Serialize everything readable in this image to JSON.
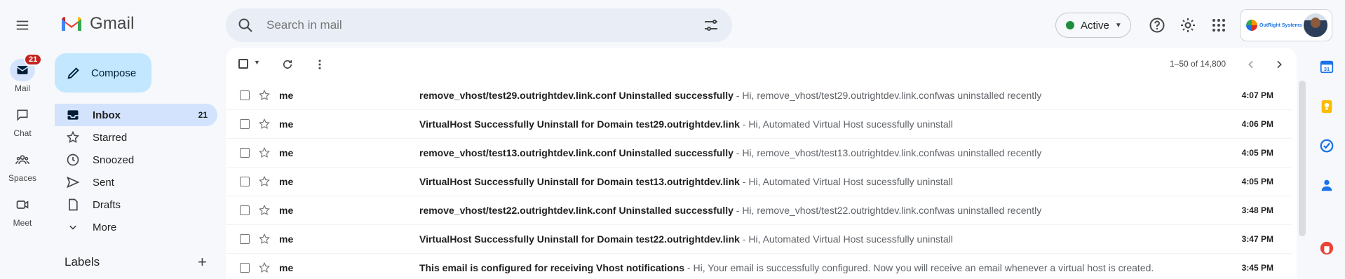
{
  "app": {
    "logo_text": "Gmail"
  },
  "search": {
    "placeholder": "Search in mail"
  },
  "status": {
    "label": "Active",
    "color": "#1e8e3e"
  },
  "account": {
    "brand_text": "OutRight Systems"
  },
  "rail": [
    {
      "label": "Mail",
      "icon": "mail-icon",
      "badge": "21",
      "active": true
    },
    {
      "label": "Chat",
      "icon": "chat-icon"
    },
    {
      "label": "Spaces",
      "icon": "spaces-icon"
    },
    {
      "label": "Meet",
      "icon": "meet-icon"
    }
  ],
  "compose": {
    "label": "Compose"
  },
  "nav": [
    {
      "label": "Inbox",
      "icon": "inbox-icon",
      "count": "21",
      "active": true
    },
    {
      "label": "Starred",
      "icon": "star-icon"
    },
    {
      "label": "Snoozed",
      "icon": "clock-icon"
    },
    {
      "label": "Sent",
      "icon": "send-icon"
    },
    {
      "label": "Drafts",
      "icon": "draft-icon"
    },
    {
      "label": "More",
      "icon": "chevron-down-icon"
    }
  ],
  "labels": {
    "title": "Labels",
    "add": "+"
  },
  "pager": {
    "text": "1–50 of 14,800"
  },
  "emails": [
    {
      "sender": "me",
      "subject": "remove_vhost/test29.outrightdev.link.conf Uninstalled successfully",
      "snippet": " - Hi, remove_vhost/test29.outrightdev.link.confwas uninstalled recently",
      "time": "4:07 PM"
    },
    {
      "sender": "me",
      "subject": "VirtualHost Successfully Uninstall for Domain test29.outrightdev.link",
      "snippet": " - Hi, Automated Virtual Host sucessfully uninstall",
      "time": "4:06 PM"
    },
    {
      "sender": "me",
      "subject": "remove_vhost/test13.outrightdev.link.conf Uninstalled successfully",
      "snippet": " - Hi, remove_vhost/test13.outrightdev.link.confwas uninstalled recently",
      "time": "4:05 PM"
    },
    {
      "sender": "me",
      "subject": "VirtualHost Successfully Uninstall for Domain test13.outrightdev.link",
      "snippet": " - Hi, Automated Virtual Host sucessfully uninstall",
      "time": "4:05 PM"
    },
    {
      "sender": "me",
      "subject": "remove_vhost/test22.outrightdev.link.conf Uninstalled successfully",
      "snippet": " - Hi, remove_vhost/test22.outrightdev.link.confwas uninstalled recently",
      "time": "3:48 PM"
    },
    {
      "sender": "me",
      "subject": "VirtualHost Successfully Uninstall for Domain test22.outrightdev.link",
      "snippet": " - Hi, Automated Virtual Host sucessfully uninstall",
      "time": "3:47 PM"
    },
    {
      "sender": "me",
      "subject": "This email is configured for receiving Vhost notifications",
      "snippet": " - Hi, Your email is successfully configured. Now you will receive an email whenever a virtual host is created.",
      "time": "3:45 PM"
    }
  ],
  "side_panel": [
    {
      "icon": "calendar-icon",
      "color": "#1a73e8",
      "text": "31"
    },
    {
      "icon": "keep-icon",
      "color": "#fbbc04"
    },
    {
      "icon": "tasks-icon",
      "color": "#1a73e8"
    },
    {
      "icon": "contacts-icon",
      "color": "#1a73e8"
    },
    {
      "icon": "addon-icon",
      "color": "#ea4335"
    }
  ],
  "colors": {
    "accent": "#0b57d0",
    "compose_bg": "#c2e7ff",
    "selected_nav": "#d3e3fd",
    "badge": "#c5221f"
  }
}
